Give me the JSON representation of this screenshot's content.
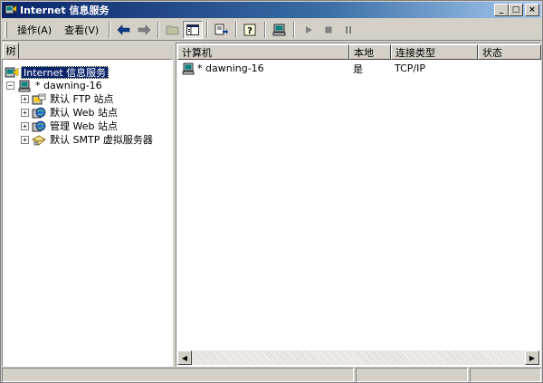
{
  "window": {
    "title": "Internet 信息服务",
    "controls": {
      "minimize": "_",
      "maximize": "□",
      "close": "×"
    }
  },
  "menubar": {
    "items": [
      {
        "label": "操作(A)"
      },
      {
        "label": "查看(V)"
      }
    ]
  },
  "toolbar": {
    "buttons": [
      {
        "icon": "back-arrow-icon"
      },
      {
        "icon": "forward-arrow-icon"
      },
      {
        "icon": "up-folder-icon"
      },
      {
        "icon": "show-hide-tree-icon"
      },
      {
        "icon": "export-list-icon"
      },
      {
        "icon": "help-icon"
      },
      {
        "icon": "computer-icon"
      },
      {
        "icon": "play-icon"
      },
      {
        "icon": "stop-icon"
      },
      {
        "icon": "pause-icon"
      }
    ]
  },
  "tree": {
    "tab_label": "树",
    "nodes": [
      {
        "label": "Internet 信息服务",
        "selected": true,
        "expander": "",
        "icon": "iis-icon"
      },
      {
        "label": "* dawning-16",
        "expander": "−",
        "icon": "computer-icon"
      },
      {
        "label": "默认 FTP 站点",
        "expander": "+",
        "icon": "ftp-site-icon"
      },
      {
        "label": "默认 Web 站点",
        "expander": "+",
        "icon": "web-site-icon"
      },
      {
        "label": "管理 Web 站点",
        "expander": "+",
        "icon": "web-site-icon"
      },
      {
        "label": "默认 SMTP 虚拟服务器",
        "expander": "+",
        "icon": "smtp-server-icon"
      }
    ]
  },
  "list": {
    "columns": [
      "计算机",
      "本地",
      "连接类型",
      "状态"
    ],
    "rows": [
      {
        "computer": "* dawning-16",
        "local": "是",
        "connection": "TCP/IP",
        "status": ""
      }
    ]
  },
  "scrollbar": {
    "left": "◀",
    "right": "▶"
  },
  "colors": {
    "title_start": "#0a246a",
    "title_end": "#a6caf0",
    "selection": "#0a246a",
    "face": "#d4d0c8"
  }
}
